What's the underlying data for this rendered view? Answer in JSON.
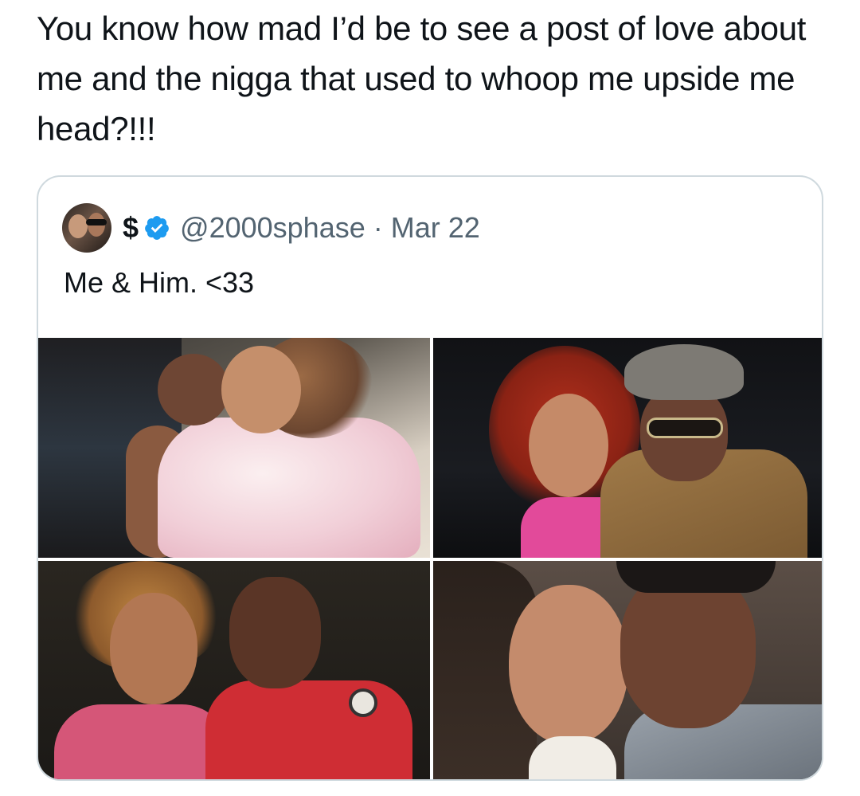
{
  "post": {
    "text": "You know how mad I’d be to see a post of love about me and the nigga that used to whoop me upside me head?!!!"
  },
  "quote": {
    "display_name": "$",
    "verified": true,
    "handle": "@2000sphase",
    "separator": "·",
    "date": "Mar 22",
    "text": "Me & Him. <33",
    "media_count": 4
  },
  "colors": {
    "text_primary": "#0f1419",
    "text_secondary": "#536471",
    "border": "#cfd9de",
    "verified_badge": "#1d9bf0"
  },
  "icons": {
    "verified": "verified-badge-icon",
    "avatar": "user-avatar"
  }
}
